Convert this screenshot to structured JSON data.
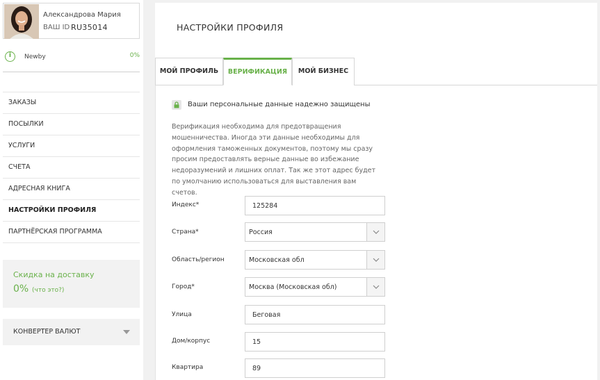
{
  "user": {
    "name": "Александрова Мария",
    "id_label": "ВАШ ID",
    "id_value": "RU35014"
  },
  "level": {
    "name": "Newby",
    "progress": "0%"
  },
  "menu": [
    {
      "label": "ЗАКАЗЫ"
    },
    {
      "label": "ПОСЫЛКИ"
    },
    {
      "label": "УСЛУГИ"
    },
    {
      "label": "СЧЕТА"
    },
    {
      "label": "АДРЕСНАЯ КНИГА"
    },
    {
      "label": "НАСТРОЙКИ ПРОФИЛЯ",
      "active": true
    },
    {
      "label": "ПАРТНЁРСКАЯ ПРОГРАММА"
    }
  ],
  "discount": {
    "title": "Скидка на доставку",
    "value": "0%",
    "link": "(что это?)"
  },
  "converter": {
    "label": "КОНВЕРТЕР ВАЛЮТ"
  },
  "page": {
    "title": "НАСТРОЙКИ ПРОФИЛЯ"
  },
  "tabs": [
    {
      "label": "МОЙ ПРОФИЛЬ"
    },
    {
      "label": "ВЕРИФИКАЦИЯ",
      "active": true
    },
    {
      "label": "МОЙ БИЗНЕС"
    }
  ],
  "verification": {
    "secure_text": "Ваши персональные данные надежно защищены",
    "description": "Верификация необходима для предотвращения мошенничества. Иногда эти данные необходимы для оформления таможенных документов, поэтому мы сразу просим предоставлять верные данные во избежание недоразумений и лишних оплат. Так же этот адрес будет по умолчанию использоваться для выставления вам счетов."
  },
  "form": {
    "index": {
      "label": "Индекс*",
      "value": "125284"
    },
    "country": {
      "label": "Страна*",
      "value": "Россия"
    },
    "region": {
      "label": "Область/регион",
      "value": "Московская обл"
    },
    "city": {
      "label": "Город*",
      "value": "Москва (Московская обл)"
    },
    "street": {
      "label": "Улица",
      "value": "Беговая"
    },
    "house": {
      "label": "Дом/корпус",
      "value": "15"
    },
    "apartment": {
      "label": "Квартира",
      "value": "89"
    }
  },
  "colors": {
    "accent": "#69b14a",
    "panel": "#f2f2f2",
    "background": "#f1f1f1"
  },
  "icons": [
    "info-icon",
    "lock-icon",
    "chevron-down-icon"
  ]
}
